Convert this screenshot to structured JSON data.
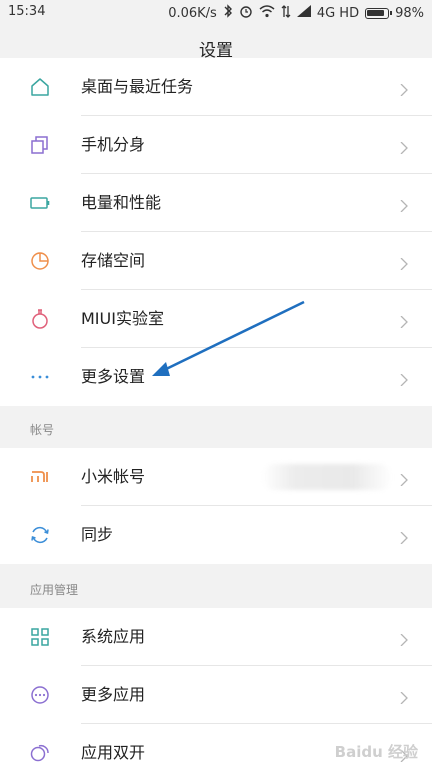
{
  "status_bar": {
    "time": "15:34",
    "network_speed": "0.06K/s",
    "network_type": "4G HD",
    "battery": "98%"
  },
  "page": {
    "title": "设置"
  },
  "sections": [
    {
      "header": "",
      "items": [
        {
          "label": "桌面与最近任务",
          "icon": "home-icon"
        },
        {
          "label": "手机分身",
          "icon": "clone-icon"
        },
        {
          "label": "电量和性能",
          "icon": "battery-icon"
        },
        {
          "label": "存储空间",
          "icon": "storage-pie-icon"
        },
        {
          "label": "MIUI实验室",
          "icon": "flask-icon"
        },
        {
          "label": "更多设置",
          "icon": "more-dots-icon"
        }
      ]
    },
    {
      "header": "帐号",
      "items": [
        {
          "label": "小米帐号",
          "icon": "mi-logo-icon"
        },
        {
          "label": "同步",
          "icon": "sync-icon"
        }
      ]
    },
    {
      "header": "应用管理",
      "items": [
        {
          "label": "系统应用",
          "icon": "grid-apps-icon"
        },
        {
          "label": "更多应用",
          "icon": "more-circle-icon"
        },
        {
          "label": "应用双开",
          "icon": "dual-apps-icon"
        }
      ]
    }
  ],
  "colors": {
    "teal": "#3aa6a0",
    "purple": "#8b6fd1",
    "orange": "#ef8f4a",
    "pink": "#e0607a",
    "blue": "#3b8ed8",
    "arrow": "#1f6fbf"
  },
  "watermark": "Baidu 经验"
}
